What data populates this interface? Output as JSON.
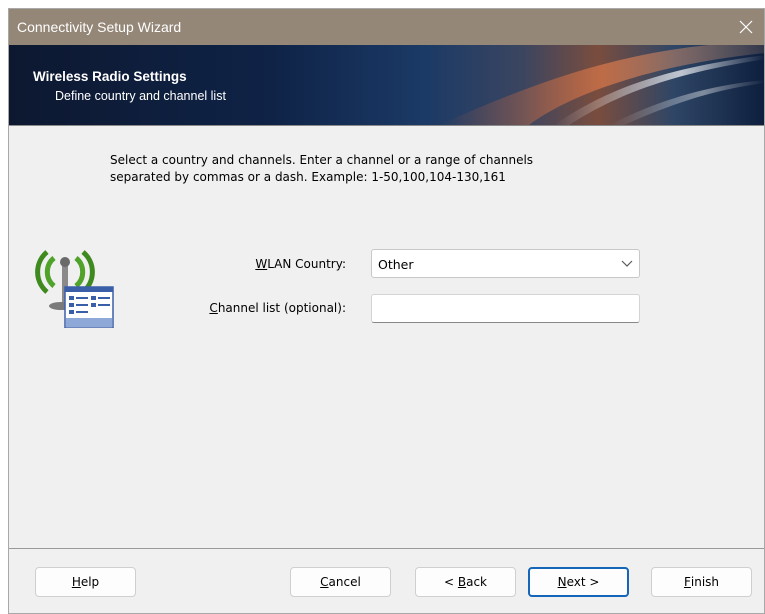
{
  "window": {
    "title": "Connectivity Setup Wizard",
    "close_icon": "close-icon"
  },
  "header": {
    "title": "Wireless Radio Settings",
    "subtitle": "Define country and channel list"
  },
  "instructions": {
    "line1": "Select a country and channels. Enter a channel or a range of channels",
    "line2": "separated by commas or a dash. Example: 1-50,100,104-130,161"
  },
  "icon": "wireless-radio-icon",
  "form": {
    "country": {
      "label_mnemonic": "W",
      "label_rest": "LAN Country:",
      "value": "Other"
    },
    "channels": {
      "label_mnemonic": "C",
      "label_rest": "hannel list (optional):",
      "value": "",
      "placeholder": ""
    }
  },
  "buttons": {
    "help": {
      "mnemonic": "H",
      "rest": "elp"
    },
    "cancel": {
      "mnemonic": "C",
      "rest": "ancel"
    },
    "back": {
      "prefix": "< ",
      "mnemonic": "B",
      "rest": "ack"
    },
    "next": {
      "mnemonic": "N",
      "rest": "ext >"
    },
    "finish": {
      "mnemonic": "F",
      "rest": "inish"
    }
  },
  "colors": {
    "titlebar": "#948777",
    "header_dark": "#0f2347",
    "accent_orange": "#c9633a",
    "default_button_border": "#1366b8",
    "icon_green": "#3f8a1e"
  }
}
